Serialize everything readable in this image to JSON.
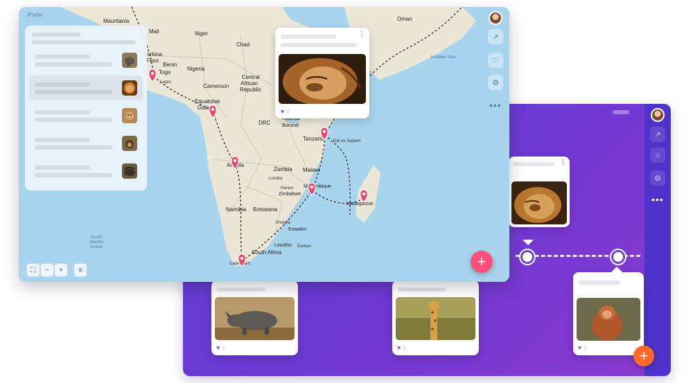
{
  "colors": {
    "accent_purple": "#6b39d2",
    "pin_pink": "#f0446e",
    "fab_pink": "#ff4f7a",
    "fab_orange": "#ff6a2b",
    "like": "#7b5cf0",
    "ocean": "#a9d4ee"
  },
  "front_window": {
    "logo_text": "iPadel",
    "map_labels": {
      "mauritania": "Mauritania",
      "mali": "Mali",
      "niger": "Niger",
      "chad": "Chad",
      "oman": "Oman",
      "burkina": "Burkina",
      "faso": "Faso",
      "benin": "Benin",
      "togo": "Togo",
      "nigeria": "Nigeria",
      "car1": "Central",
      "car2": "African",
      "car3": "Republic",
      "cameroon": "Cameroon",
      "eqguinea1": "Equatorial",
      "eqguinea2": "Guinea",
      "drc": "DRC",
      "rwanda": "Rwanda",
      "burundi": "Burundi",
      "tanzania": "Tanzania",
      "angola": "Angola",
      "zambia": "Zambia",
      "malawi": "Malawi",
      "mozambique": "Mozambique",
      "zimbabwe": "Zimbabwe",
      "madagascar": "Madagascar",
      "namibia": "Namibia",
      "botswana": "Botswana",
      "eswatini": "Eswatini",
      "lesotho": "Lesotho",
      "south_africa": "South Africa",
      "cape_town": "Cape Town",
      "lagos": "Lagos",
      "lusaka": "Lusaka",
      "harare": "Harare",
      "pretoria": "Pretoria",
      "durban": "Durban",
      "dar_es_salaam": "Dar es Salaam",
      "arabian_sea": "Arabian Sea",
      "south_atlantic": "South Atlantic Ocean"
    },
    "popup": {
      "menu_icon": "⋮",
      "likes": "2"
    },
    "fab_label": "+",
    "rail_icons": [
      "share-icon",
      "heart-icon",
      "settings-icon"
    ],
    "rail_more": "•••",
    "map_controls": [
      "fullscreen-icon",
      "zoom-out-icon",
      "zoom-in-icon",
      "list-icon"
    ]
  },
  "back_window": {
    "rail_icons": [
      "share-icon",
      "star-icon",
      "settings-icon"
    ],
    "rail_more": "•••",
    "fab_label": "+",
    "cards": [
      {
        "animal": "lion",
        "menu": "⋮"
      },
      {
        "animal": "rhino",
        "likes": "3"
      },
      {
        "animal": "giraffe",
        "likes": "5"
      },
      {
        "animal": "orangutan",
        "likes": "2"
      }
    ]
  }
}
